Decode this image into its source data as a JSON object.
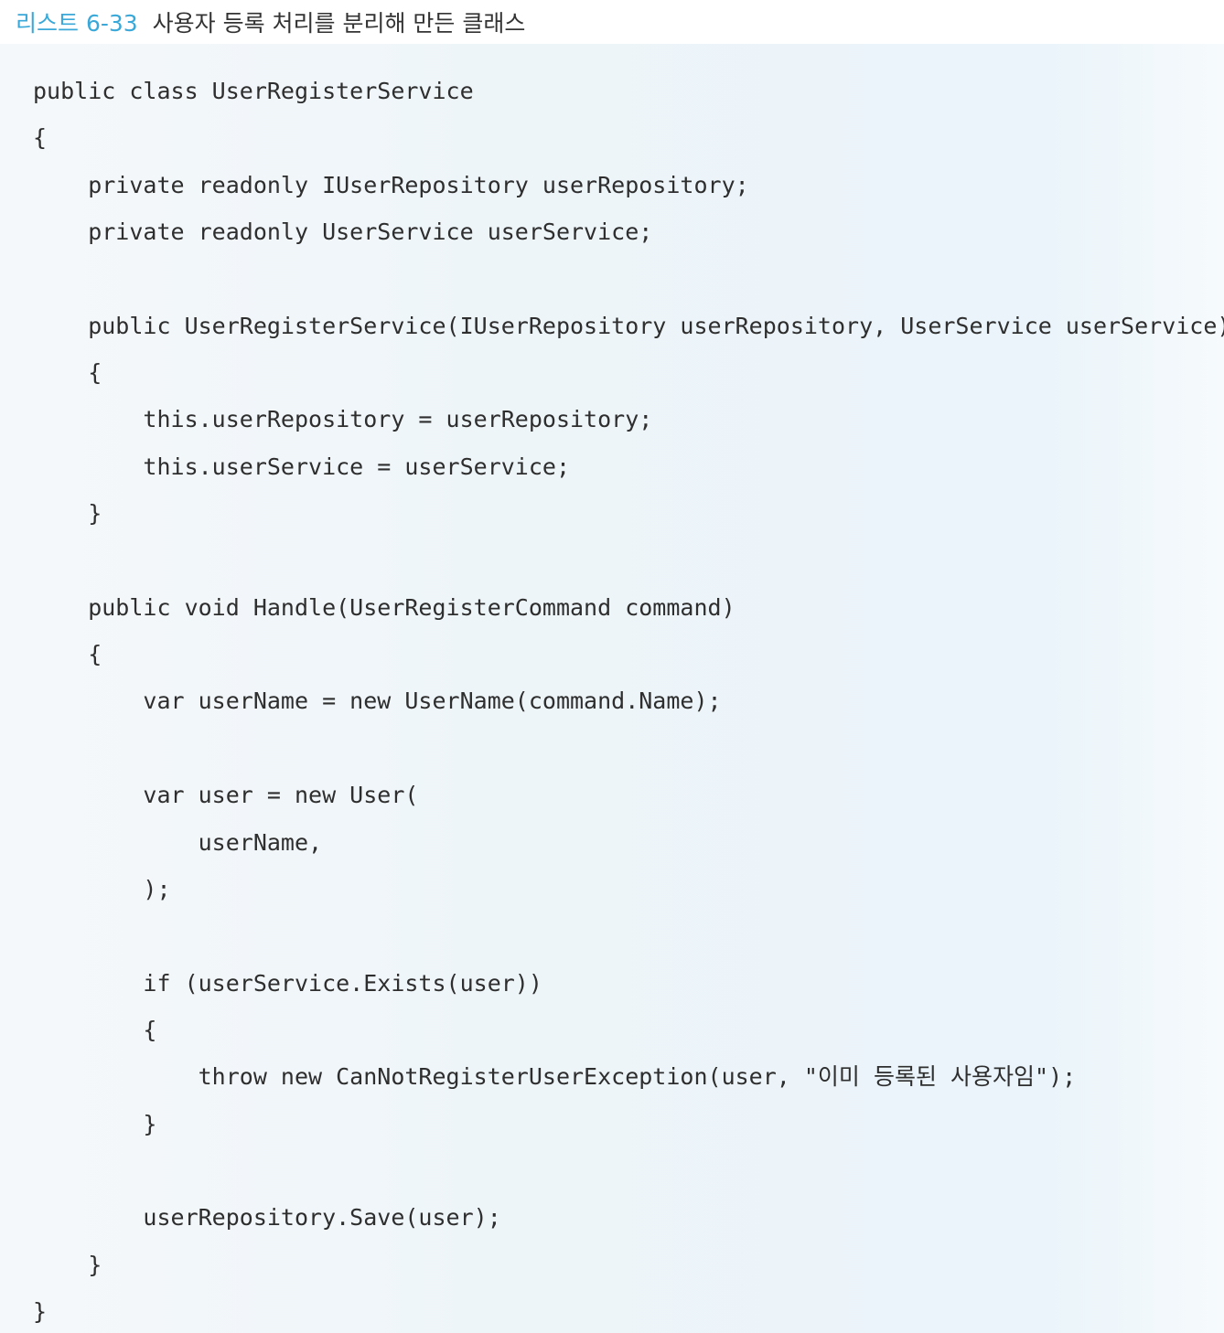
{
  "caption": {
    "number": "리스트 6-33",
    "title": "사용자 등록 처리를 분리해 만든 클래스"
  },
  "code": {
    "language": "C#",
    "lines": [
      "public class UserRegisterService",
      "{",
      "    private readonly IUserRepository userRepository;",
      "    private readonly UserService userService;",
      "",
      "    public UserRegisterService(IUserRepository userRepository, UserService userService)",
      "    {",
      "        this.userRepository = userRepository;",
      "        this.userService = userService;",
      "    }",
      "",
      "    public void Handle(UserRegisterCommand command)",
      "    {",
      "        var userName = new UserName(command.Name);",
      "",
      "        var user = new User(",
      "            userName,",
      "        );",
      "",
      "        if (userService.Exists(user))",
      "        {",
      "            throw new CanNotRegisterUserException(user, \"이미 등록된 사용자임\");",
      "        }",
      "",
      "        userRepository.Save(user);",
      "    }",
      "}"
    ]
  },
  "colors": {
    "caption_number": "#3aa8d8",
    "caption_title": "#333333",
    "code_text": "#2e2e2e",
    "code_background": "#eef5f9"
  }
}
